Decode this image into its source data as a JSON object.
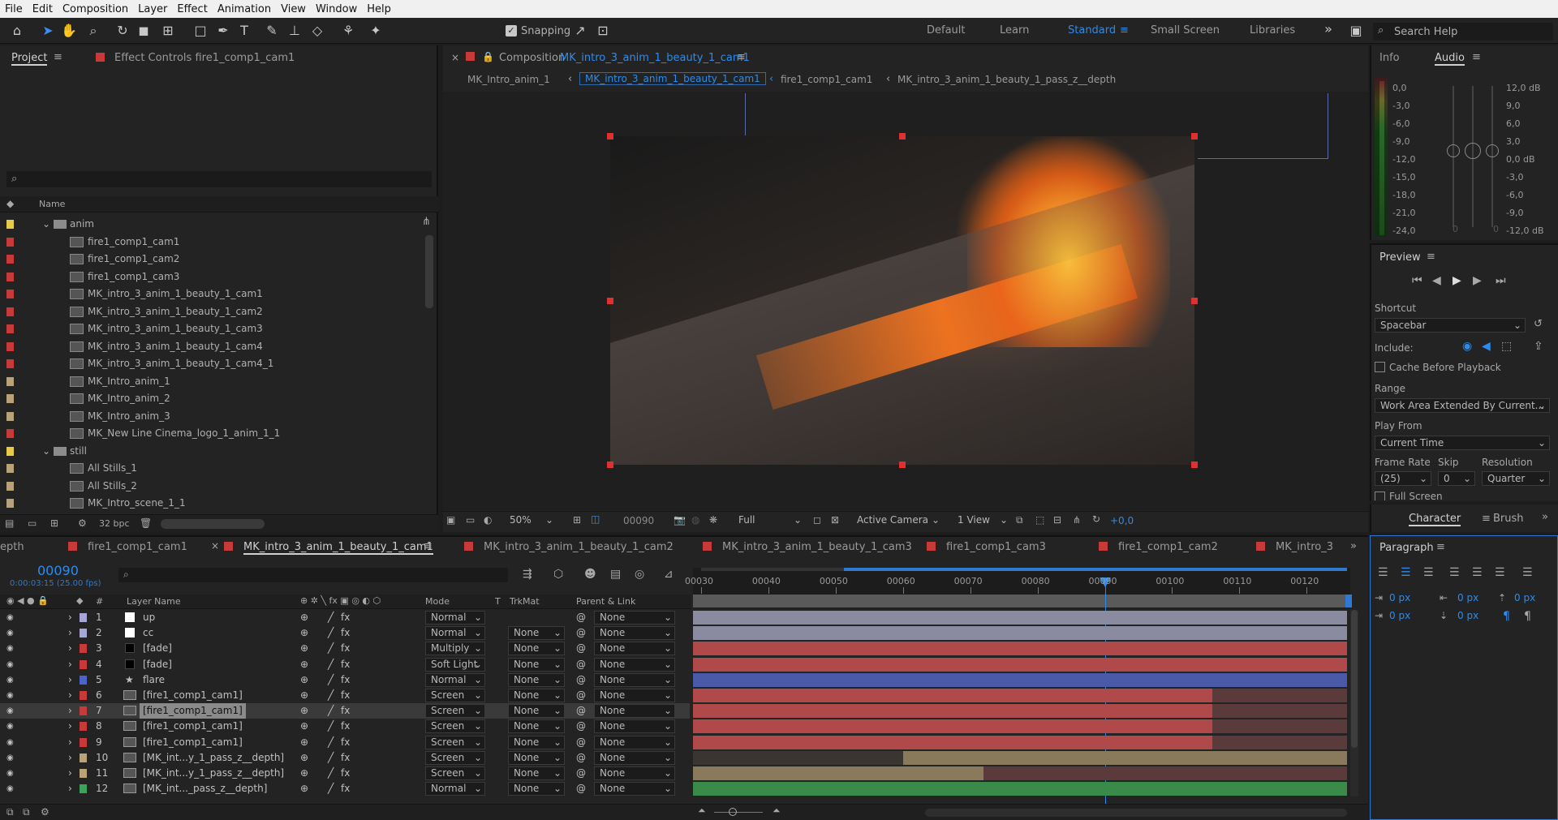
{
  "menu": [
    "File",
    "Edit",
    "Composition",
    "Layer",
    "Effect",
    "Animation",
    "View",
    "Window",
    "Help"
  ],
  "toolbar": {
    "snapping": "Snapping",
    "workspaces": [
      "Default",
      "Learn",
      "Standard",
      "Small Screen",
      "Libraries"
    ],
    "active_workspace": "Standard",
    "search_placeholder": "Search Help"
  },
  "project": {
    "tab": "Project",
    "effect_tab": "Effect Controls fire1_comp1_cam1",
    "search_placeholder": "",
    "name_header": "Name",
    "bpc": "32 bpc",
    "items": [
      {
        "label": "anim",
        "type": "folder",
        "color": "#e8c94a"
      },
      {
        "label": "fire1_comp1_cam1",
        "type": "comp",
        "color": "#c83a3a"
      },
      {
        "label": "fire1_comp1_cam2",
        "type": "comp",
        "color": "#c83a3a"
      },
      {
        "label": "fire1_comp1_cam3",
        "type": "comp",
        "color": "#c83a3a"
      },
      {
        "label": "MK_intro_3_anim_1_beauty_1_cam1",
        "type": "comp",
        "color": "#c83a3a"
      },
      {
        "label": "MK_intro_3_anim_1_beauty_1_cam2",
        "type": "comp",
        "color": "#c83a3a"
      },
      {
        "label": "MK_intro_3_anim_1_beauty_1_cam3",
        "type": "comp",
        "color": "#c83a3a"
      },
      {
        "label": "MK_intro_3_anim_1_beauty_1_cam4",
        "type": "comp",
        "color": "#c83a3a"
      },
      {
        "label": "MK_intro_3_anim_1_beauty_1_cam4_1",
        "type": "comp",
        "color": "#c83a3a"
      },
      {
        "label": "MK_Intro_anim_1",
        "type": "comp",
        "color": "#b9a27a"
      },
      {
        "label": "MK_Intro_anim_2",
        "type": "comp",
        "color": "#b9a27a"
      },
      {
        "label": "MK_Intro_anim_3",
        "type": "comp",
        "color": "#b9a27a"
      },
      {
        "label": "MK_New Line Cinema_logo_1_anim_1_1",
        "type": "comp",
        "color": "#c83a3a"
      },
      {
        "label": "still",
        "type": "folder",
        "color": "#e8c94a"
      },
      {
        "label": "All Stills_1",
        "type": "comp",
        "color": "#b9a27a"
      },
      {
        "label": "All Stills_2",
        "type": "comp",
        "color": "#b9a27a"
      },
      {
        "label": "MK_Intro_scene_1_1",
        "type": "comp",
        "color": "#b9a27a"
      }
    ]
  },
  "composition": {
    "label": "Composition",
    "name": "MK_intro_3_anim_1_beauty_1_cam1",
    "breadcrumbs": [
      "MK_Intro_anim_1",
      "MK_intro_3_anim_1_beauty_1_cam1",
      "fire1_comp1_cam1",
      "MK_intro_3_anim_1_beauty_1_pass_z__depth"
    ],
    "zoom": "50%",
    "timecode": "00090",
    "resolution": "Full",
    "camera": "Active Camera",
    "views": "1 View",
    "exposure": "+0,0"
  },
  "info_panel": {
    "tab_info": "Info",
    "tab_audio": "Audio",
    "left_scale": [
      "0,0",
      "-3,0",
      "-6,0",
      "-9,0",
      "-12,0",
      "-15,0",
      "-18,0",
      "-21,0",
      "-24,0"
    ],
    "right_scale": [
      "12,0 dB",
      "9,0",
      "6,0",
      "3,0",
      "0,0 dB",
      "-3,0",
      "-6,0",
      "-9,0",
      "-12,0 dB"
    ],
    "slider_left": "0",
    "slider_right": "0"
  },
  "preview": {
    "title": "Preview",
    "shortcut_label": "Shortcut",
    "shortcut": "Spacebar",
    "include": "Include:",
    "cache": "Cache Before Playback",
    "range_label": "Range",
    "range": "Work Area Extended By Current...",
    "play_from_label": "Play From",
    "play_from": "Current Time",
    "frame_rate_label": "Frame Rate",
    "skip_label": "Skip",
    "resolution_label": "Resolution",
    "frame_rate": "(25)",
    "skip": "0",
    "resolution": "Quarter",
    "full_screen": "Full Screen"
  },
  "char_tabs": [
    "Character",
    "Brush"
  ],
  "paragraph": {
    "title": "Paragraph",
    "values": [
      "0 px",
      "0 px",
      "0 px",
      "0 px",
      "0 px"
    ]
  },
  "timeline": {
    "tabs": [
      "epth",
      "fire1_comp1_cam1",
      "MK_intro_3_anim_1_beauty_1_cam1",
      "MK_intro_3_anim_1_beauty_1_cam2",
      "MK_intro_3_anim_1_beauty_1_cam3",
      "fire1_comp1_cam3",
      "fire1_comp1_cam2",
      "MK_intro_3"
    ],
    "active_tab": "MK_intro_3_anim_1_beauty_1_cam1",
    "timecode": "00090",
    "timecode_sub": "0:00:03:15 (25.00 fps)",
    "headers": {
      "num": "#",
      "layer": "Layer Name",
      "mode": "Mode",
      "t": "T",
      "trkmat": "TrkMat",
      "parent": "Parent & Link"
    },
    "ruler": [
      "00030",
      "00040",
      "00050",
      "00060",
      "00070",
      "00080",
      "00090",
      "00100",
      "00110",
      "00120"
    ],
    "playhead_frame": 90,
    "layers": [
      {
        "n": "1",
        "name": "up",
        "mode": "Normal",
        "trk": "",
        "parent": "None",
        "color": "#a7a7d6",
        "icon": "solid-white",
        "bar": "#8a8aa0",
        "start": 30,
        "end": 126
      },
      {
        "n": "2",
        "name": "cc",
        "mode": "Normal",
        "trk": "None",
        "parent": "None",
        "color": "#a7a7d6",
        "icon": "solid-white",
        "bar": "#8a8aa0",
        "start": 30,
        "end": 126
      },
      {
        "n": "3",
        "name": "[fade]",
        "mode": "Multiply",
        "trk": "None",
        "parent": "None",
        "color": "#c83a3a",
        "icon": "solid-black",
        "bar": "#b04a4a",
        "start": 30,
        "end": 126
      },
      {
        "n": "4",
        "name": "[fade]",
        "mode": "Soft Light",
        "trk": "None",
        "parent": "None",
        "color": "#c83a3a",
        "icon": "solid-black",
        "bar": "#b04a4a",
        "start": 30,
        "end": 126
      },
      {
        "n": "5",
        "name": "flare",
        "mode": "Normal",
        "trk": "None",
        "parent": "None",
        "color": "#4a64c8",
        "icon": "star",
        "bar": "#4a5aa8",
        "start": 30,
        "end": 126
      },
      {
        "n": "6",
        "name": "[fire1_comp1_cam1]",
        "mode": "Screen",
        "trk": "None",
        "parent": "None",
        "color": "#c83a3a",
        "icon": "comp",
        "bar": "#b04a4a",
        "start": 30,
        "end": 106
      },
      {
        "n": "7",
        "name": "[fire1_comp1_cam1]",
        "mode": "Screen",
        "trk": "None",
        "parent": "None",
        "color": "#c83a3a",
        "icon": "comp",
        "bar": "#b04a4a",
        "start": 30,
        "end": 106,
        "selected": true
      },
      {
        "n": "8",
        "name": "[fire1_comp1_cam1]",
        "mode": "Screen",
        "trk": "None",
        "parent": "None",
        "color": "#c83a3a",
        "icon": "comp",
        "bar": "#b04a4a",
        "start": 30,
        "end": 106
      },
      {
        "n": "9",
        "name": "[fire1_comp1_cam1]",
        "mode": "Screen",
        "trk": "None",
        "parent": "None",
        "color": "#c83a3a",
        "icon": "comp",
        "bar": "#b04a4a",
        "start": 30,
        "end": 106
      },
      {
        "n": "10",
        "name": "[MK_int...y_1_pass_z__depth]",
        "mode": "Screen",
        "trk": "None",
        "parent": "None",
        "color": "#b9a27a",
        "icon": "comp",
        "bar": "#8a7a5c",
        "start": 60,
        "end": 126
      },
      {
        "n": "11",
        "name": "[MK_int...y_1_pass_z__depth]",
        "mode": "Screen",
        "trk": "None",
        "parent": "None",
        "color": "#b9a27a",
        "icon": "comp",
        "bar": "#8a7a5c",
        "start": 30,
        "end": 72
      },
      {
        "n": "12",
        "name": "[MK_int..._pass_z__depth]",
        "mode": "Normal",
        "trk": "None",
        "parent": "None",
        "color": "#3aa35a",
        "icon": "comp",
        "bar": "#3a8a4a",
        "start": 30,
        "end": 126
      }
    ]
  }
}
